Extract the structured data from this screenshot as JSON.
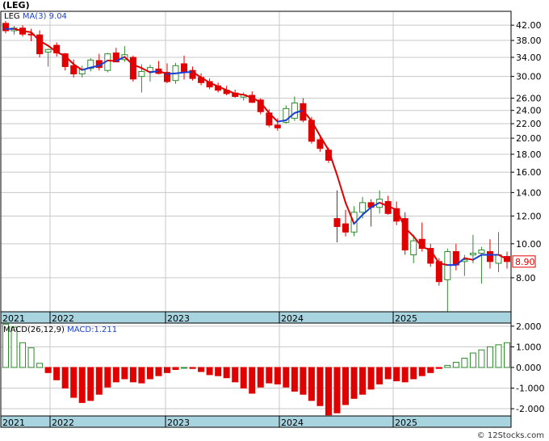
{
  "header": {
    "ticker": "(LEG)",
    "symbol": "LEG",
    "ma_label": "MA(3)",
    "ma_value": "9.04"
  },
  "macd_panel": {
    "label": "MACD(26,12,9)",
    "value_label": "MACD:1.211"
  },
  "credit": "© 12Stocks.com",
  "colors": {
    "up": "#2e8b2e",
    "down": "#e00000",
    "ma_up": "#1a3fd6",
    "ma_down": "#e00000",
    "axis_band": "#a8d4e0"
  },
  "chart_data": [
    {
      "type": "candlestick",
      "scale": "log",
      "ylim": [
        6.4,
        46
      ],
      "yticks": [
        "42.00",
        "38.00",
        "34.00",
        "30.00",
        "26.00",
        "24.00",
        "22.00",
        "20.00",
        "18.00",
        "16.00",
        "14.00",
        "12.00",
        "10.00",
        "8.00"
      ],
      "last_price_label": "8.90",
      "x_labels": [
        "2021",
        "2022",
        "2023",
        "2024",
        "2025"
      ],
      "series": [
        {
          "name": "LEG",
          "ohlc": [
            [
              42.5,
              43.2,
              39.8,
              40.5
            ],
            [
              40.5,
              41.8,
              39.5,
              41.2
            ],
            [
              41.2,
              42.0,
              39.0,
              39.6
            ],
            [
              39.6,
              41.0,
              37.8,
              39.4
            ],
            [
              39.4,
              40.6,
              34.0,
              34.8
            ],
            [
              35.2,
              36.0,
              32.0,
              35.8
            ],
            [
              36.8,
              37.5,
              34.2,
              35.0
            ],
            [
              34.8,
              35.0,
              31.2,
              32.0
            ],
            [
              32.2,
              33.5,
              29.8,
              30.5
            ],
            [
              30.5,
              32.2,
              29.8,
              31.4
            ],
            [
              31.6,
              33.8,
              31.0,
              33.4
            ],
            [
              33.3,
              34.8,
              31.2,
              31.8
            ],
            [
              31.2,
              35.0,
              30.8,
              34.8
            ],
            [
              35.0,
              36.2,
              33.0,
              33.0
            ],
            [
              33.5,
              36.6,
              33.0,
              34.6
            ],
            [
              34.0,
              34.4,
              29.0,
              29.5
            ],
            [
              30.0,
              32.5,
              27.0,
              31.0
            ],
            [
              31.0,
              32.4,
              29.0,
              31.8
            ],
            [
              31.5,
              33.2,
              30.4,
              30.6
            ],
            [
              30.8,
              32.7,
              28.7,
              29.0
            ],
            [
              29.2,
              32.8,
              28.6,
              32.2
            ],
            [
              32.6,
              34.4,
              29.4,
              31.0
            ],
            [
              31.2,
              32.0,
              29.2,
              29.6
            ],
            [
              29.8,
              30.6,
              28.3,
              28.8
            ],
            [
              29.0,
              29.6,
              27.6,
              28.0
            ],
            [
              28.2,
              28.8,
              27.0,
              27.4
            ],
            [
              27.4,
              28.2,
              26.5,
              26.8
            ],
            [
              26.9,
              27.5,
              26.1,
              26.3
            ],
            [
              26.2,
              27.0,
              25.6,
              26.6
            ],
            [
              26.5,
              27.2,
              25.2,
              25.3
            ],
            [
              25.7,
              26.0,
              23.4,
              23.8
            ],
            [
              23.6,
              24.2,
              21.5,
              21.8
            ],
            [
              21.8,
              22.8,
              21.0,
              21.4
            ],
            [
              22.2,
              24.8,
              22.0,
              24.3
            ],
            [
              22.8,
              26.3,
              22.4,
              25.2
            ],
            [
              25.1,
              26.0,
              22.2,
              22.5
            ],
            [
              22.5,
              23.0,
              19.3,
              19.6
            ],
            [
              19.8,
              20.3,
              18.3,
              18.7
            ],
            [
              18.5,
              18.8,
              17.0,
              17.3
            ],
            [
              11.8,
              14.2,
              10.1,
              11.2
            ],
            [
              11.4,
              12.5,
              10.5,
              10.8
            ],
            [
              10.8,
              12.8,
              10.5,
              12.3
            ],
            [
              12.3,
              13.6,
              11.8,
              13.1
            ],
            [
              13.1,
              13.4,
              11.2,
              12.7
            ],
            [
              12.7,
              14.2,
              12.2,
              13.4
            ],
            [
              13.2,
              13.7,
              12.1,
              12.2
            ],
            [
              12.6,
              13.2,
              11.3,
              11.6
            ],
            [
              11.8,
              12.3,
              9.3,
              9.6
            ],
            [
              9.3,
              10.6,
              8.8,
              10.2
            ],
            [
              10.3,
              11.5,
              9.5,
              9.7
            ],
            [
              9.7,
              10.0,
              8.6,
              8.8
            ],
            [
              8.9,
              9.1,
              7.6,
              7.8
            ],
            [
              7.9,
              9.7,
              6.4,
              9.5
            ],
            [
              9.5,
              10.0,
              8.4,
              8.7
            ],
            [
              8.9,
              9.3,
              8.1,
              9.0
            ],
            [
              9.3,
              10.6,
              8.8,
              9.4
            ],
            [
              9.4,
              9.8,
              7.7,
              9.6
            ],
            [
              9.5,
              10.3,
              8.5,
              8.9
            ],
            [
              8.8,
              10.8,
              8.3,
              9.3
            ],
            [
              9.2,
              9.5,
              8.5,
              8.9
            ]
          ]
        },
        {
          "name": "MA(3)",
          "values": [
            41.0,
            41.0,
            40.4,
            40.1,
            37.9,
            36.7,
            35.2,
            34.3,
            32.5,
            31.3,
            31.8,
            32.2,
            33.3,
            33.2,
            34.1,
            32.4,
            31.7,
            30.8,
            31.1,
            30.5,
            30.6,
            30.8,
            30.9,
            29.8,
            28.8,
            28.1,
            27.4,
            26.8,
            26.6,
            26.1,
            25.3,
            23.6,
            22.3,
            22.5,
            23.6,
            24.0,
            22.4,
            20.3,
            18.5,
            15.7,
            13.1,
            11.4,
            12.1,
            12.7,
            13.1,
            12.8,
            12.5,
            11.1,
            10.5,
            9.8,
            9.6,
            8.8,
            8.7,
            8.7,
            9.1,
            9.0,
            9.3,
            9.3,
            9.3,
            9.04
          ]
        }
      ]
    },
    {
      "type": "bar",
      "title": "MACD(26,12,9)",
      "ylim": [
        -2.35,
        2.15
      ],
      "yticks": [
        "2.000",
        "1.000",
        "0.000",
        "-1.000",
        "-2.000"
      ],
      "x_labels": [
        "2021",
        "2022",
        "2023",
        "2024",
        "2025"
      ],
      "values": [
        2.1,
        1.95,
        1.2,
        0.95,
        0.2,
        -0.25,
        -0.6,
        -1.0,
        -1.45,
        -1.7,
        -1.6,
        -1.3,
        -0.95,
        -0.7,
        -0.55,
        -0.7,
        -0.75,
        -0.55,
        -0.4,
        -0.25,
        -0.1,
        0.0,
        -0.05,
        -0.2,
        -0.35,
        -0.4,
        -0.5,
        -0.7,
        -1.0,
        -1.25,
        -0.95,
        -0.75,
        -0.8,
        -0.95,
        -1.15,
        -1.3,
        -1.6,
        -1.85,
        -2.3,
        -2.2,
        -1.8,
        -1.5,
        -1.3,
        -1.05,
        -0.8,
        -0.55,
        -0.65,
        -0.7,
        -0.55,
        -0.4,
        -0.25,
        -0.05,
        0.1,
        0.25,
        0.45,
        0.7,
        0.85,
        1.0,
        1.1,
        1.2
      ]
    }
  ]
}
